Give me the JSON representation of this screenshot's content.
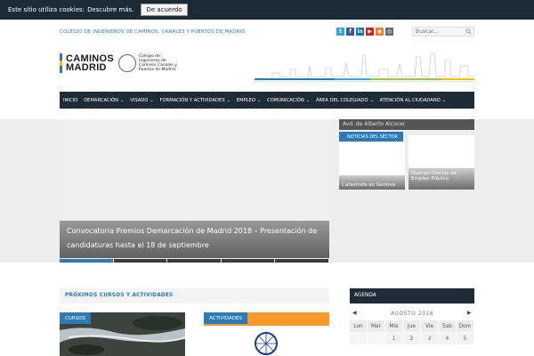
{
  "cookie": {
    "text": "Este sitio utiliza cookies:",
    "more_link": "Descubre más.",
    "accept_label": "De acuerdo"
  },
  "topbar": {
    "org_name": "COLEGIO DE INGENIEROS DE CAMINOS, CANALES Y PUERTOS DE MADRID",
    "social": [
      {
        "name": "twitter",
        "color": "#2aa9e0",
        "glyph": "t"
      },
      {
        "name": "facebook",
        "color": "#3b5998",
        "glyph": "f"
      },
      {
        "name": "linkedin",
        "color": "#0e76a8",
        "glyph": "in"
      },
      {
        "name": "youtube",
        "color": "#cc2222",
        "glyph": "▶"
      },
      {
        "name": "rss",
        "color": "#f07b1f",
        "glyph": "◉"
      },
      {
        "name": "instagram",
        "color": "#5f6e7a",
        "glyph": "◎"
      }
    ],
    "search_placeholder": "Buscar..."
  },
  "header": {
    "logo_line1": "CAMINOS",
    "logo_line2": "MADRID",
    "logo_sub": "Colegio de Ingenieros de Caminos Canales y Puertos de Madrid"
  },
  "nav": {
    "items": [
      {
        "label": "INICIO",
        "has_menu": false
      },
      {
        "label": "DEMARCACIÓN",
        "has_menu": true
      },
      {
        "label": "VISADO",
        "has_menu": true
      },
      {
        "label": "FORMACIÓN Y ACTIVIDADES",
        "has_menu": true
      },
      {
        "label": "EMPLEO",
        "has_menu": true
      },
      {
        "label": "COMUNICACIÓN",
        "has_menu": true
      },
      {
        "label": "ÁREA DEL COLEGIADO",
        "has_menu": true
      },
      {
        "label": "ATENCIÓN AL CIUDADANO",
        "has_menu": true
      }
    ]
  },
  "slider": {
    "caption_line1": "Convocatoria Premios Demarcación de Madrid 2018 – Presentación de",
    "caption_line2": "candidaturas hasta el 18 de septiembre"
  },
  "sidebar": {
    "top_item": "Avd. de Alberto Alcocer",
    "news_tab": "NOTICIAS DEL SECTOR",
    "news": [
      {
        "caption": "Catastrofe en Genova"
      },
      {
        "caption": "Nuevas Ofertas de Empleo Público"
      }
    ]
  },
  "courses": {
    "title": "PRÓXIMOS CURSOS Y ACTIVIDADES",
    "cards": [
      {
        "label": "CURSOS"
      },
      {
        "label": "ACTIVIDADES"
      }
    ]
  },
  "agenda": {
    "title": "AGENDA",
    "month": "AGOSTO 2018",
    "prev": "◀",
    "next": "▶",
    "weekdays": [
      "Lun",
      "Mar",
      "Mie",
      "Jue",
      "Vie",
      "Sab",
      "Dom"
    ],
    "week1": [
      "",
      "",
      "1",
      "2",
      "3",
      "4",
      "5"
    ]
  },
  "colors": {
    "accent": "#2c7bb6",
    "nav_bg": "#1e2c38",
    "cookie_bg": "#1c2a35"
  }
}
